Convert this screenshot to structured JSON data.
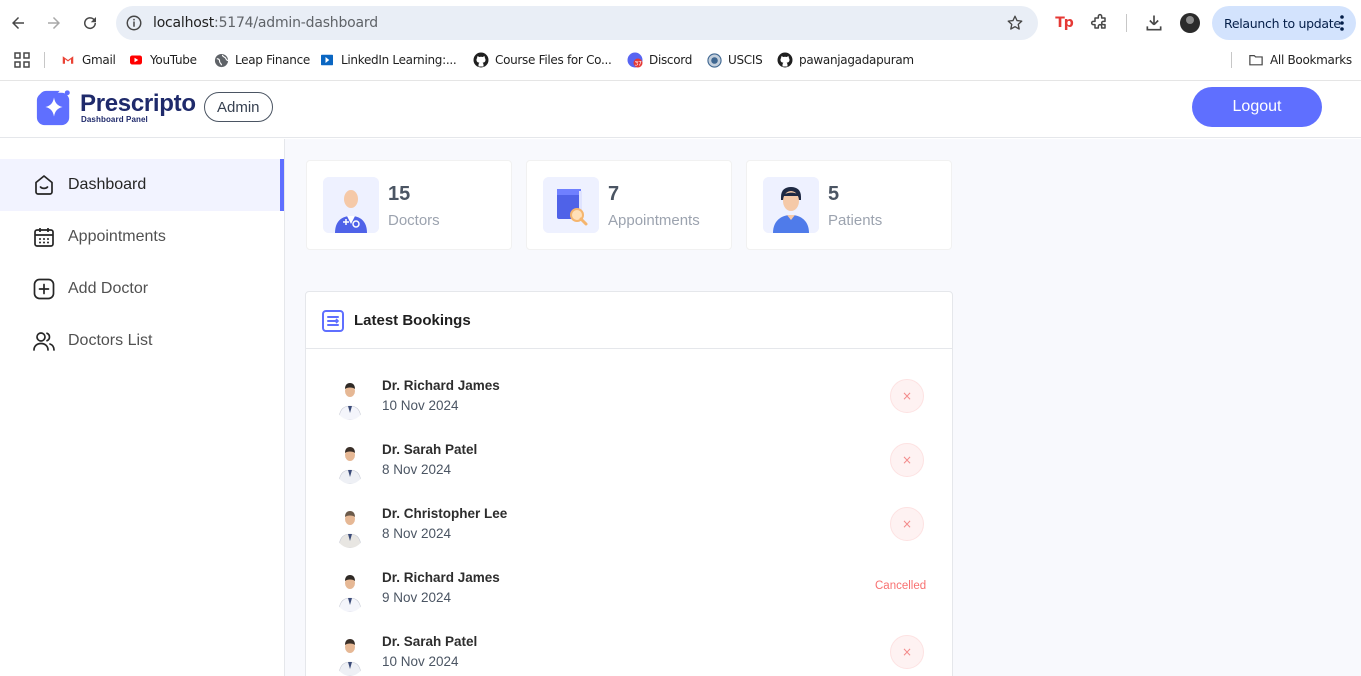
{
  "browser": {
    "url_host": "localhost",
    "url_path": ":5174/admin-dashboard",
    "relaunch_label": "Relaunch to update",
    "bookmarks": [
      {
        "label": "Gmail",
        "icon": "gmail-icon"
      },
      {
        "label": "YouTube",
        "icon": "youtube-icon"
      },
      {
        "label": "Leap Finance",
        "icon": "globe-icon"
      },
      {
        "label": "LinkedIn Learning:...",
        "icon": "linkedin-learning-icon"
      },
      {
        "label": "Course Files for Co...",
        "icon": "github-icon"
      },
      {
        "label": "Discord",
        "icon": "discord-icon"
      },
      {
        "label": "USCIS",
        "icon": "uscis-icon"
      },
      {
        "label": "pawanjagadapuram",
        "icon": "github-icon"
      }
    ],
    "all_bookmarks_label": "All Bookmarks"
  },
  "header": {
    "brand": "Prescripto",
    "brand_sub": "Dashboard Panel",
    "role": "Admin",
    "logout_label": "Logout"
  },
  "sidebar": {
    "items": [
      {
        "label": "Dashboard",
        "icon": "home-icon",
        "active": true
      },
      {
        "label": "Appointments",
        "icon": "calendar-icon",
        "active": false
      },
      {
        "label": "Add Doctor",
        "icon": "add-square-icon",
        "active": false
      },
      {
        "label": "Doctors List",
        "icon": "people-icon",
        "active": false
      }
    ]
  },
  "stats": [
    {
      "value": "15",
      "label": "Doctors",
      "icon": "doctor-icon"
    },
    {
      "value": "7",
      "label": "Appointments",
      "icon": "appointment-book-icon"
    },
    {
      "value": "5",
      "label": "Patients",
      "icon": "patient-icon"
    }
  ],
  "bookings": {
    "title": "Latest Bookings",
    "rows": [
      {
        "doctor": "Dr. Richard James",
        "date": "10 Nov 2024",
        "cancelled": false,
        "action": "×"
      },
      {
        "doctor": "Dr. Sarah Patel",
        "date": "8 Nov 2024",
        "cancelled": false,
        "action": "×"
      },
      {
        "doctor": "Dr. Christopher Lee",
        "date": "8 Nov 2024",
        "cancelled": false,
        "action": "×"
      },
      {
        "doctor": "Dr. Richard James",
        "date": "9 Nov 2024",
        "cancelled": true,
        "status": "Cancelled"
      },
      {
        "doctor": "Dr. Sarah Patel",
        "date": "10 Nov 2024",
        "cancelled": false,
        "action": "×"
      }
    ]
  },
  "colors": {
    "accent": "#5f6fff",
    "active_bg": "#f2f3ff",
    "cancel_text": "#f87171",
    "main_bg": "#f8f9fd"
  }
}
